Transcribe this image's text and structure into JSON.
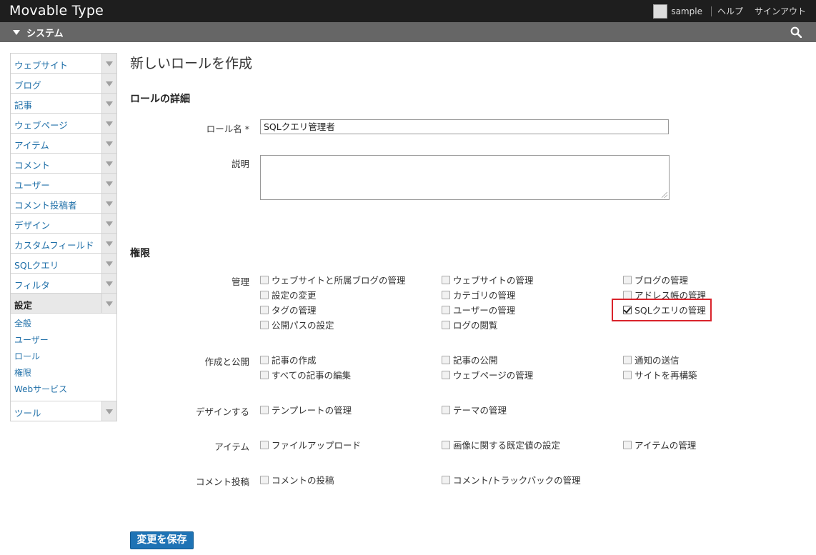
{
  "app": {
    "title": "Movable Type"
  },
  "topnav": {
    "user": "sample",
    "help": "ヘルプ",
    "signout": "サインアウト"
  },
  "subbar": {
    "scope": "システム"
  },
  "sidebar": {
    "items": [
      "ウェブサイト",
      "ブログ",
      "記事",
      "ウェブページ",
      "アイテム",
      "コメント",
      "ユーザー",
      "コメント投稿者",
      "デザイン",
      "カスタムフィールド",
      "SQLクエリ",
      "フィルタ"
    ],
    "active": "設定",
    "settings_sub": [
      "全般",
      "ユーザー",
      "ロール",
      "権限",
      "Webサービス"
    ],
    "tools": "ツール"
  },
  "page": {
    "title": "新しいロールを作成"
  },
  "details": {
    "heading": "ロールの詳細",
    "name_label": "ロール名 *",
    "name_value": "SQLクエリ管理者",
    "desc_label": "説明"
  },
  "permissions": {
    "heading": "権限",
    "groups": [
      {
        "label": "管理",
        "items": [
          {
            "text": "ウェブサイトと所属ブログの管理",
            "checked": false
          },
          {
            "text": "ウェブサイトの管理",
            "checked": false
          },
          {
            "text": "ブログの管理",
            "checked": false
          },
          {
            "text": "設定の変更",
            "checked": false
          },
          {
            "text": "カテゴリの管理",
            "checked": false
          },
          {
            "text": "アドレス帳の管理",
            "checked": false
          },
          {
            "text": "タグの管理",
            "checked": false
          },
          {
            "text": "ユーザーの管理",
            "checked": false
          },
          {
            "text": "SQLクエリの管理",
            "checked": true
          },
          {
            "text": "公開パスの設定",
            "checked": false
          },
          {
            "text": "ログの閲覧",
            "checked": false
          }
        ]
      },
      {
        "label": "作成と公開",
        "items": [
          {
            "text": "記事の作成",
            "checked": false
          },
          {
            "text": "記事の公開",
            "checked": false
          },
          {
            "text": "通知の送信",
            "checked": false
          },
          {
            "text": "すべての記事の編集",
            "checked": false
          },
          {
            "text": "ウェブページの管理",
            "checked": false
          },
          {
            "text": "サイトを再構築",
            "checked": false
          }
        ]
      },
      {
        "label": "デザインする",
        "items": [
          {
            "text": "テンプレートの管理",
            "checked": false
          },
          {
            "text": "テーマの管理",
            "checked": false
          }
        ]
      },
      {
        "label": "アイテム",
        "items": [
          {
            "text": "ファイルアップロード",
            "checked": false
          },
          {
            "text": "画像に関する既定値の設定",
            "checked": false
          },
          {
            "text": "アイテムの管理",
            "checked": false
          }
        ]
      },
      {
        "label": "コメント投稿",
        "items": [
          {
            "text": "コメントの投稿",
            "checked": false
          },
          {
            "text": "コメント/トラックバックの管理",
            "checked": false
          }
        ]
      }
    ]
  },
  "actions": {
    "save": "変更を保存"
  },
  "colors": {
    "accent": "#1e73b5",
    "highlight": "#d9232b",
    "link": "#1f6fa8"
  }
}
